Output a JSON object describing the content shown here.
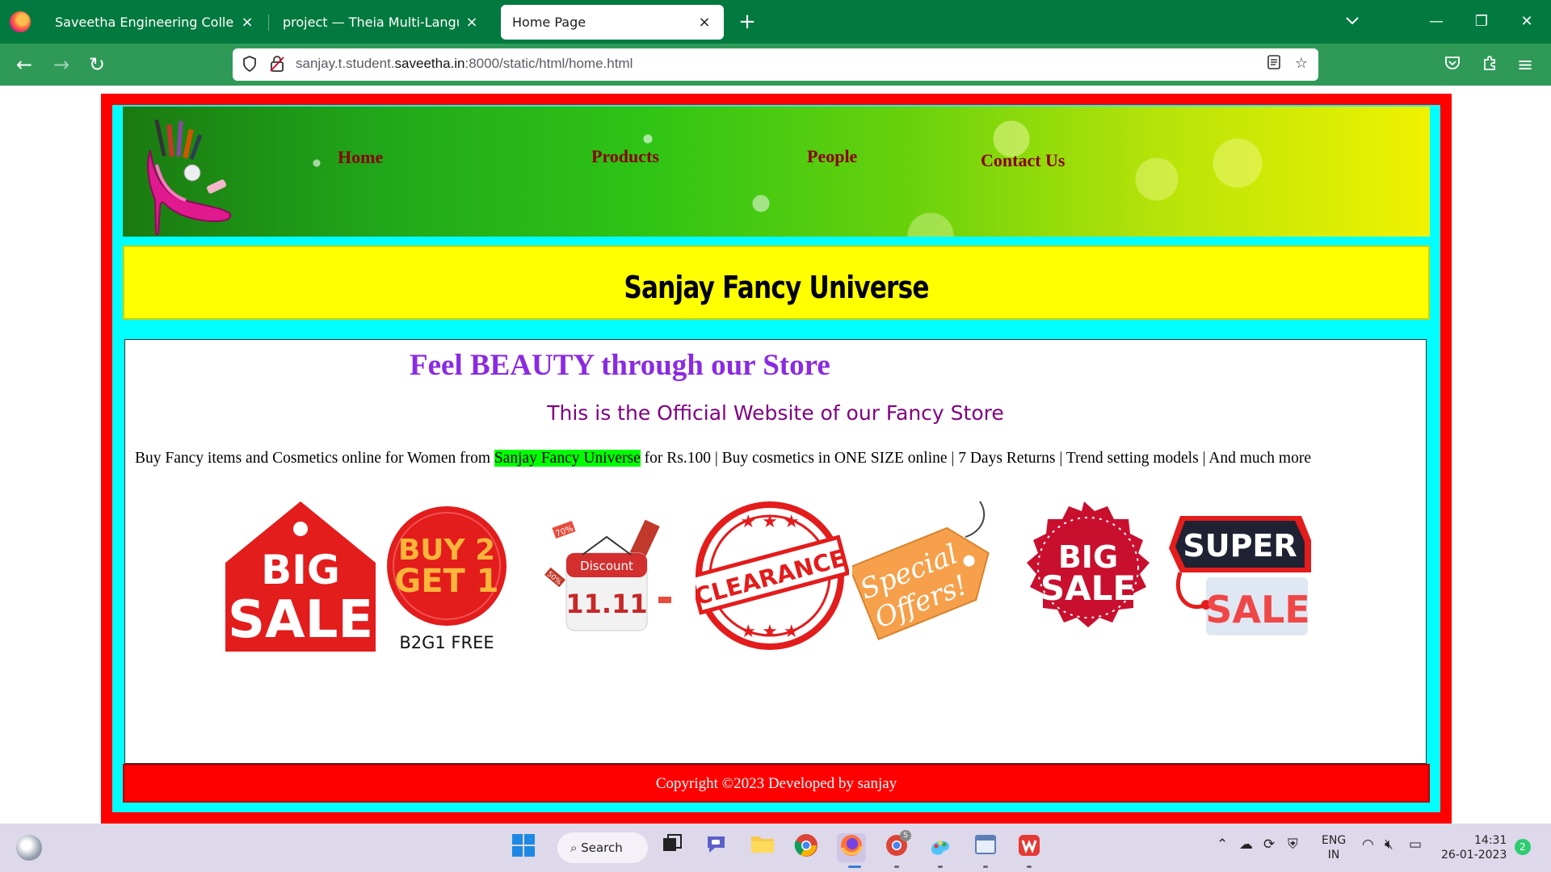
{
  "browser": {
    "tabs": [
      {
        "title": "Saveetha Engineering College",
        "close": "×"
      },
      {
        "title": "project — Theia Multi-Language Ex",
        "close": "×"
      },
      {
        "title": "Home Page",
        "close": "×"
      }
    ],
    "new_tab": "+",
    "url_host_prefix": "sanjay.t.student.",
    "url_host_domain": "saveetha.in",
    "url_rest": ":8000/static/html/home.html",
    "window_controls": {
      "minimize": "—",
      "restore": "❐",
      "close": "✕"
    }
  },
  "site": {
    "nav": [
      "Home",
      "Products",
      "People",
      "Contact Us"
    ],
    "title": "Sanjay Fancy Universe",
    "tagline": "Feel BEAUTY through our Store",
    "subtagline": "This is the Official Website of our Fancy Store",
    "description_before": "Buy Fancy items and Cosmetics online for Women from ",
    "description_highlight": "Sanjay Fancy Universe",
    "description_after": " for Rs.100 | Buy cosmetics in ONE SIZE online | 7 Days Returns | Trend setting models | And much more",
    "offers": {
      "big_sale_1": {
        "line1": "BIG",
        "line2": "SALE"
      },
      "buy2get1": {
        "line1": "BUY 2",
        "line2": "GET 1",
        "caption": "B2G1 FREE"
      },
      "discount": {
        "label": "Discount",
        "date": "11.11",
        "tag1": "70%",
        "tag2": "50%"
      },
      "clearance": {
        "text": "CLEARANCE"
      },
      "special": {
        "line1": "Special",
        "line2": "Offers!"
      },
      "big_sale_2": {
        "line1": "BIG",
        "line2": "SALE"
      },
      "super_sale": {
        "line1": "SUPER",
        "line2": "SALE"
      }
    },
    "footer": "Copyright ©2023 Developed by sanjay",
    "colors": {
      "frame": "#ff0000",
      "inner": "#00ffff",
      "banner": "#ffff00",
      "nav_text": "#8b0000",
      "tagline": "#8a2be2",
      "subtagline": "#800080",
      "highlight": "#00ff00"
    }
  },
  "taskbar": {
    "search_label": "Search",
    "language": {
      "line1": "ENG",
      "line2": "IN"
    },
    "clock": {
      "time": "14:31",
      "date": "26-01-2023"
    },
    "notification_count": "2",
    "chrome_profile_badge": "S"
  }
}
